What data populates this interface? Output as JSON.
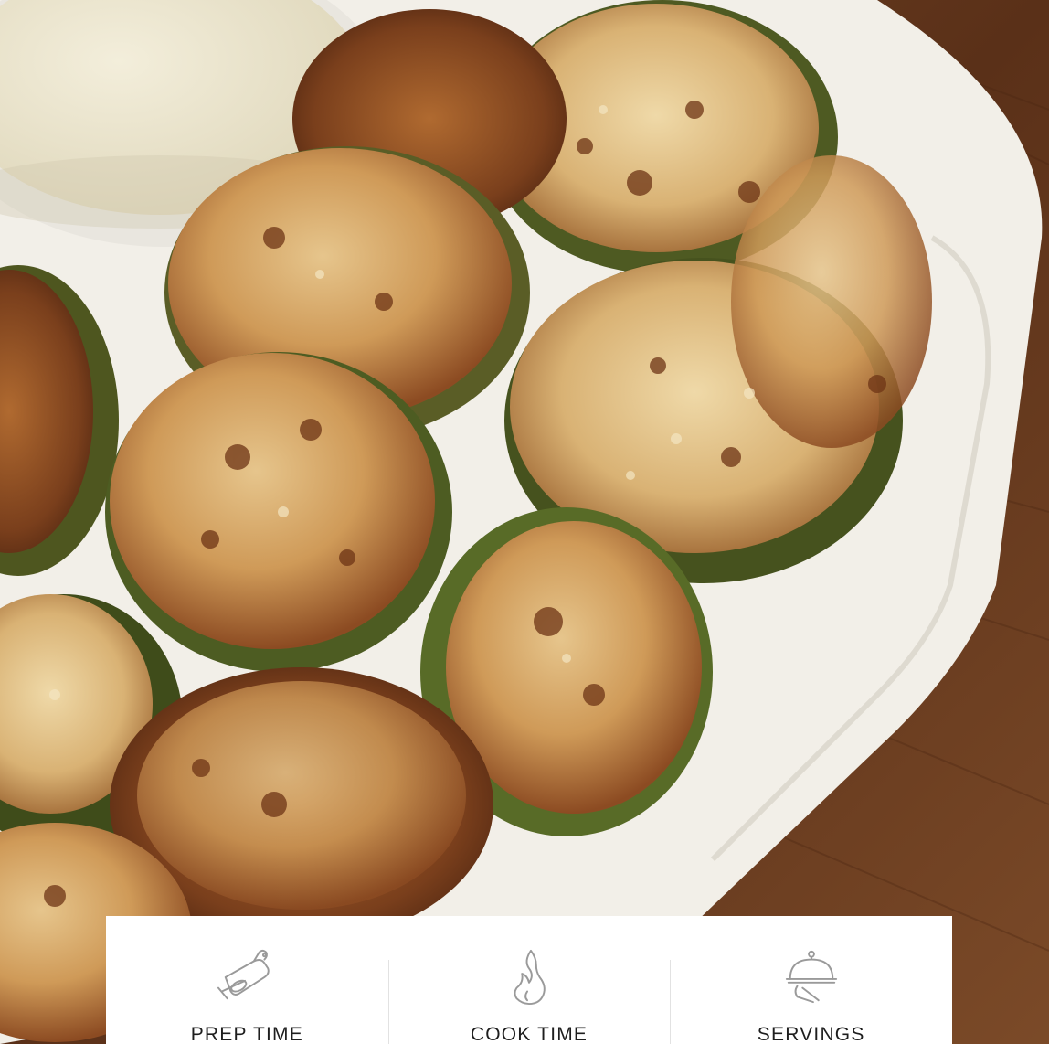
{
  "hero": {
    "subject": "fried-pickle-chips-photo",
    "colors": {
      "wood": "#6b3e22",
      "plate": "#f1eee7",
      "dip": "#ece6cf",
      "crust": "#c58a4a",
      "crust_dark": "#7a3f1c",
      "pickle": "#5c6a2a"
    }
  },
  "info_card": {
    "items": [
      {
        "label": "PREP TIME",
        "icon": "cutting-board-icon"
      },
      {
        "label": "COOK TIME",
        "icon": "flame-icon"
      },
      {
        "label": "SERVINGS",
        "icon": "serving-cloche-icon"
      }
    ],
    "colors": {
      "background": "#ffffff",
      "icon_stroke": "#9a9a9a",
      "divider": "#e2e2e2",
      "text": "#1e1e1e"
    }
  }
}
